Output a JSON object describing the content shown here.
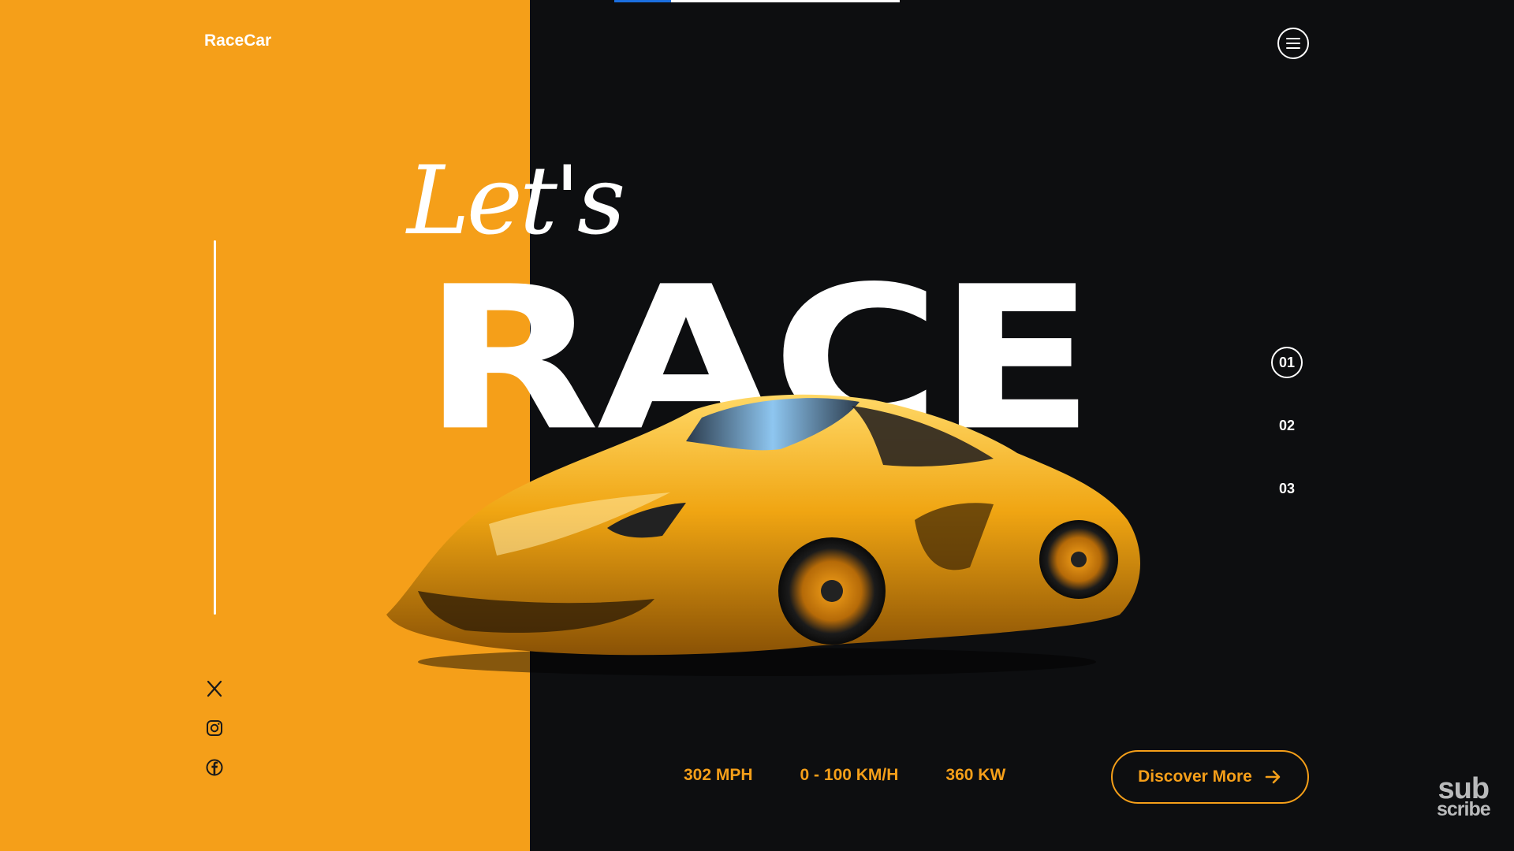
{
  "brand": {
    "logo": "RaceCar"
  },
  "topbar": {
    "progress": 0.2
  },
  "hero": {
    "script_word": "Let's",
    "headline": "RACE"
  },
  "slides": [
    {
      "label": "01",
      "active": true
    },
    {
      "label": "02",
      "active": false
    },
    {
      "label": "03",
      "active": false
    }
  ],
  "stats": [
    "302 MPH",
    "0 - 100 KM/H",
    "360 KW"
  ],
  "cta": {
    "label": "Discover More",
    "icon": "arrow-right-icon"
  },
  "social": [
    "x-icon",
    "instagram-icon",
    "facebook-icon"
  ],
  "watermark": {
    "line1": "sub",
    "line2": "scribe"
  },
  "colors": {
    "accent": "#f59f19",
    "dark": "#0d0e10",
    "progress": "#1b6fe0"
  }
}
